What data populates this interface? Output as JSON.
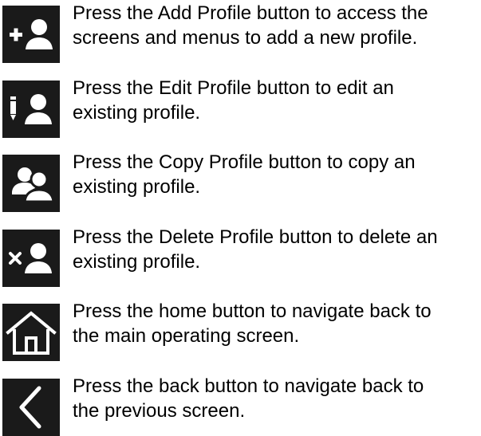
{
  "items": [
    {
      "icon": "add-profile-icon",
      "text_line1": "Press the Add Profile button to access the",
      "text_line2": "screens and menus to add a new profile."
    },
    {
      "icon": "edit-profile-icon",
      "text_line1": "Press the Edit Profile button to edit an",
      "text_line2": "existing profile."
    },
    {
      "icon": "copy-profile-icon",
      "text_line1": "Press the Copy Profile button to copy an",
      "text_line2": "existing profile."
    },
    {
      "icon": "delete-profile-icon",
      "text_line1": "Press the Delete Profile button to delete an",
      "text_line2": "existing profile."
    },
    {
      "icon": "home-icon",
      "text_line1": "Press the home button to navigate back to",
      "text_line2": "the main operating screen."
    },
    {
      "icon": "back-icon",
      "text_line1": "Press the back button to navigate back to",
      "text_line2": "the previous screen."
    }
  ],
  "colors": {
    "icon_background": "#1a1a1a",
    "icon_foreground": "#ffffff",
    "text": "#000000"
  }
}
